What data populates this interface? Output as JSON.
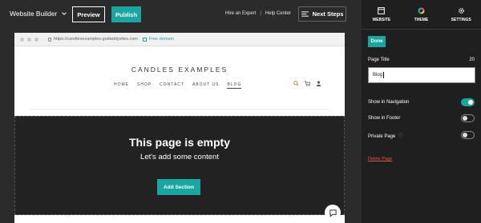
{
  "topbar": {
    "brand_label": "Website Builder",
    "preview_label": "Preview",
    "publish_label": "Publish",
    "hire_label": "Hire an Expert",
    "separator": "|",
    "help_label": "Help Center",
    "next_steps_label": "Next Steps"
  },
  "browser": {
    "url": "https://candlesexamples.godaddysites.com",
    "free_domain_label": "Free domain"
  },
  "site": {
    "title": "CANDLES EXAMPLES",
    "nav": [
      "HOME",
      "SHOP",
      "CONTACT",
      "ABOUT US",
      "BLOG"
    ],
    "active_nav": "BLOG"
  },
  "empty_section": {
    "heading": "This page is empty",
    "subheading": "Let's add some content",
    "add_label": "Add Section"
  },
  "panel": {
    "tabs": [
      "WEBSITE",
      "THEME",
      "SETTINGS"
    ],
    "done_label": "Done",
    "page_title_label": "Page Title",
    "page_title_count": "20",
    "page_title_value": "Blog",
    "show_in_navigation_label": "Show in Navigation",
    "show_in_navigation": true,
    "show_in_footer_label": "Show in Footer",
    "show_in_footer": false,
    "private_page_label": "Private Page",
    "private_page": false,
    "delete_label": "Delete Page"
  },
  "colors": {
    "accent": "#1aa6a0",
    "danger": "#e5534b",
    "panel_bg": "#1f1f1f"
  }
}
